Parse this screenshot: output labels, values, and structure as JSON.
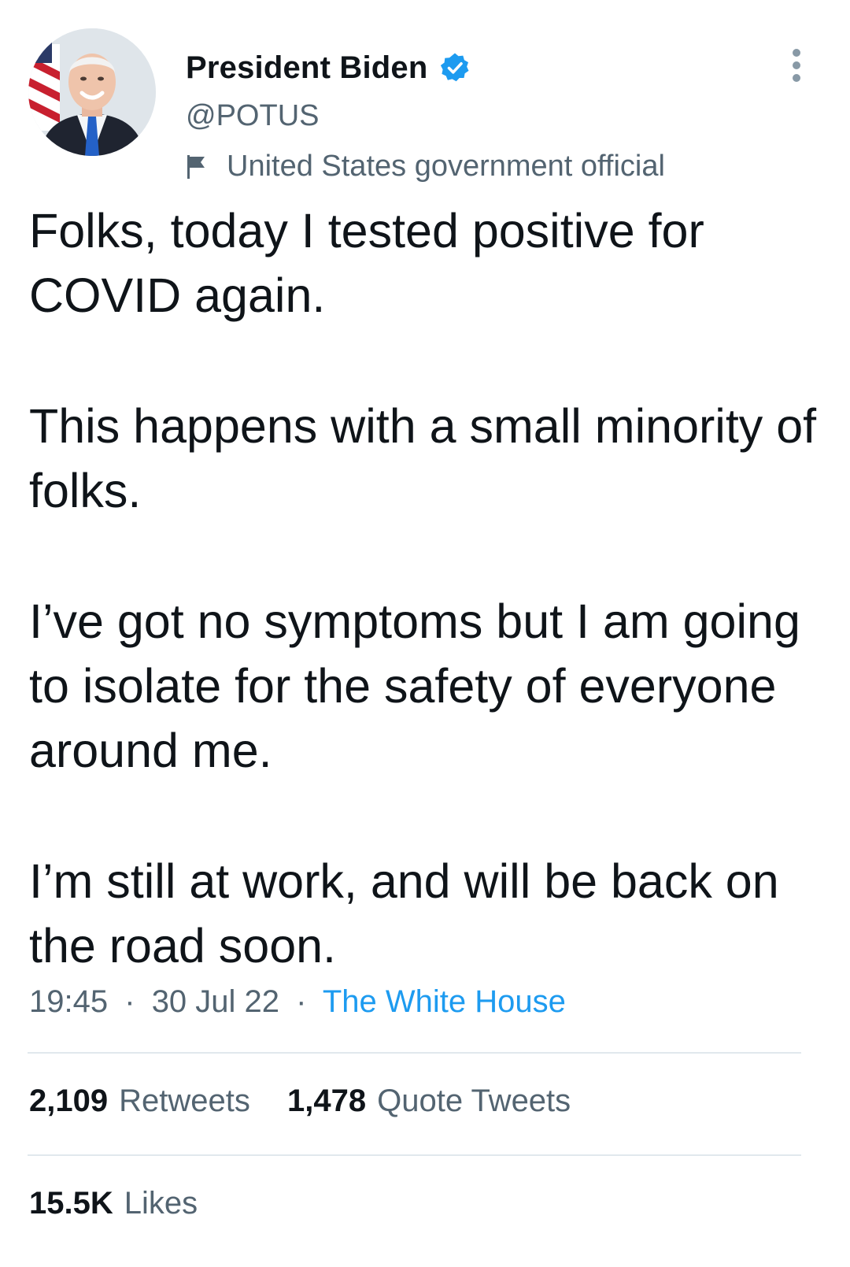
{
  "author": {
    "display_name": "President Biden",
    "handle": "@POTUS",
    "verified_icon": "verified-badge-icon",
    "label": "United States government official",
    "label_icon": "flag-icon"
  },
  "menu": {
    "icon": "more-vertical-icon"
  },
  "tweet": {
    "paragraphs": [
      "Folks, today I tested positive for COVID again.",
      "This happens with a small minority of folks.",
      "I’ve got no symptoms but I am going to isolate for the safety of everyone around me.",
      "I’m still at work, and will be back on the road soon."
    ],
    "time": "19:45",
    "separator": "·",
    "date": "30 Jul 22",
    "source": "The White House"
  },
  "stats": {
    "retweets_count": "2,109",
    "retweets_label": "Retweets",
    "quotes_count": "1,478",
    "quotes_label": "Quote Tweets",
    "likes_count": "15.5K",
    "likes_label": "Likes"
  },
  "colors": {
    "text": "#0f1419",
    "secondary": "#536471",
    "link": "#1d9bf0",
    "verified": "#1d9bf0",
    "divider": "#e1e8ed"
  }
}
